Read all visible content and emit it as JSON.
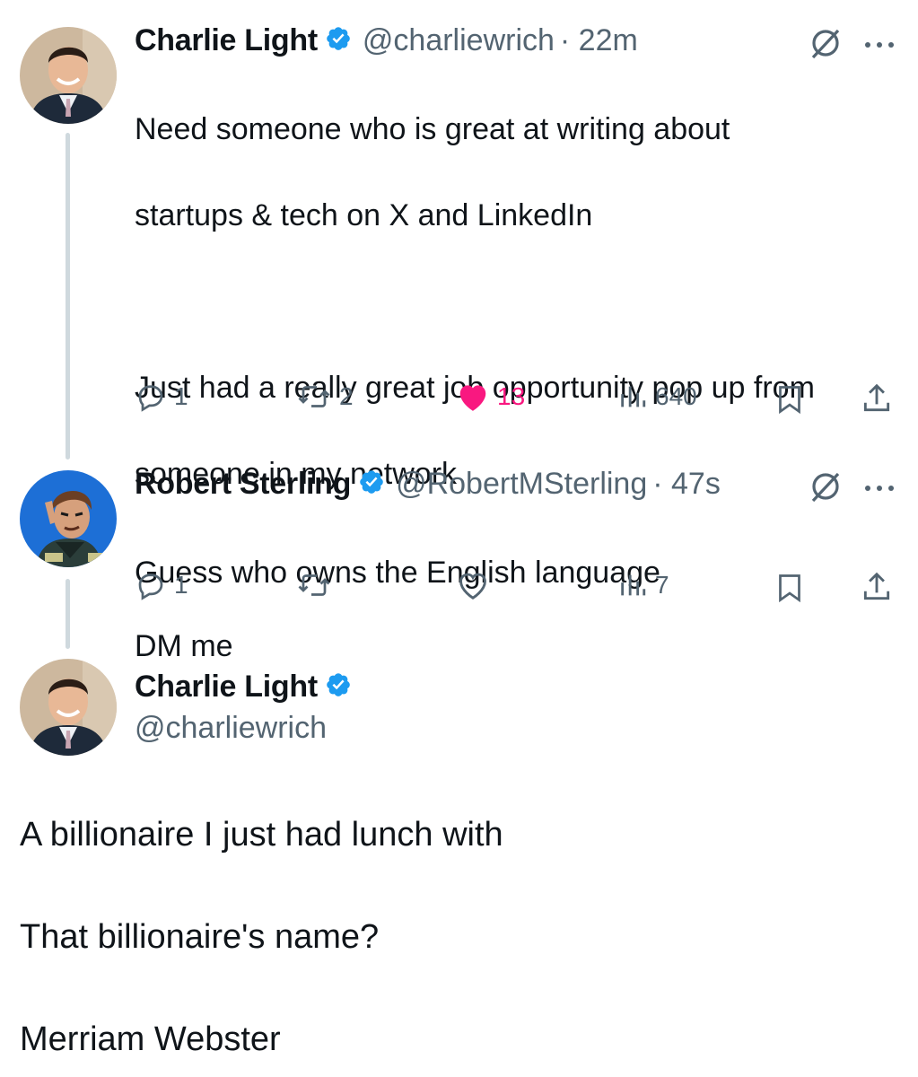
{
  "tweet1": {
    "name": "Charlie Light",
    "handle": "@charliewrich",
    "time": "· 22m",
    "lines": [
      "Need someone who is great at writing about",
      "startups & tech on X and LinkedIn",
      "Just had a really great job opportunity pop up from",
      "someone in my network",
      "DM me"
    ],
    "replies": "1",
    "reposts": "2",
    "likes": "13",
    "views": "640"
  },
  "tweet2": {
    "name": "Robert Sterling",
    "handle": "@RobertMSterling",
    "time": "· 47s",
    "text": "Guess who owns the English language",
    "replies": "1",
    "views": "7"
  },
  "tweet3": {
    "name": "Charlie Light",
    "handle": "@charliewrich",
    "lines": [
      "A billionaire I just had lunch with",
      "That billionaire's name?",
      "Merriam Webster"
    ]
  },
  "colors": {
    "verified": "#1d9bf0",
    "like": "#f91880",
    "muted": "#536471",
    "thread": "#cfd9de"
  }
}
